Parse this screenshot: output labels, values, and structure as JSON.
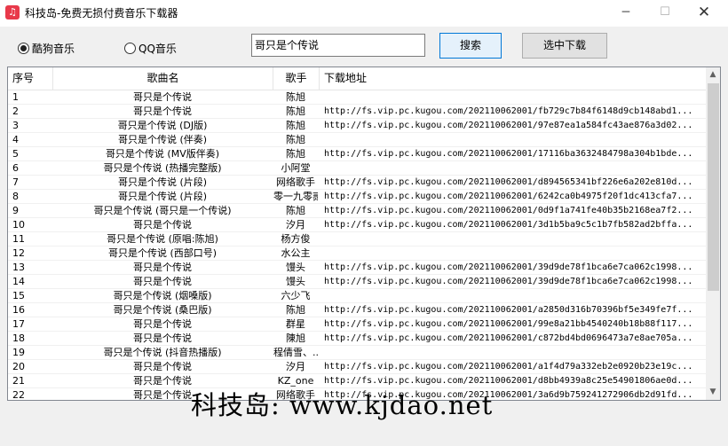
{
  "window": {
    "title": "科技岛-免费无损付费音乐下载器",
    "minimize_glyph": "─",
    "maximize_glyph": "☐",
    "close_glyph": "✕",
    "app_icon": "music-note-icon"
  },
  "toolbar": {
    "source_kugou_label": "酷狗音乐",
    "source_qq_label": "QQ音乐",
    "selected_source": "kugou",
    "search_value": "哥只是个传说",
    "search_button_label": "搜索",
    "download_selected_label": "选中下载"
  },
  "table": {
    "headers": [
      "序号",
      "歌曲名",
      "歌手",
      "下载地址"
    ],
    "rows": [
      {
        "no": "1",
        "song": "哥只是个传说",
        "singer": "陈旭",
        "url": ""
      },
      {
        "no": "2",
        "song": "哥只是个传说",
        "singer": "陈旭",
        "url": "http://fs.vip.pc.kugou.com/202110062001/fb729c7b84f6148d9cb148abd1..."
      },
      {
        "no": "3",
        "song": "哥只是个传说 (DJ版)",
        "singer": "陈旭",
        "url": "http://fs.vip.pc.kugou.com/202110062001/97e87ea1a584fc43ae876a3d02..."
      },
      {
        "no": "4",
        "song": "哥只是个传说 (伴奏)",
        "singer": "陈旭",
        "url": ""
      },
      {
        "no": "5",
        "song": "哥只是个传说 (MV版伴奏)",
        "singer": "陈旭",
        "url": "http://fs.vip.pc.kugou.com/202110062001/17116ba3632484798a304b1bde..."
      },
      {
        "no": "6",
        "song": "哥只是个传说 (热播完整版)",
        "singer": "小阿堂",
        "url": ""
      },
      {
        "no": "7",
        "song": "哥只是个传说 (片段)",
        "singer": "网络歌手",
        "url": "http://fs.vip.pc.kugou.com/202110062001/d894565341bf226e6a202e810d..."
      },
      {
        "no": "8",
        "song": "哥只是个传说 (片段)",
        "singer": "零一九零贰",
        "url": "http://fs.vip.pc.kugou.com/202110062001/6242ca0b4975f20f1dc413cfa7..."
      },
      {
        "no": "9",
        "song": "哥只是个传说 (哥只是一个传说)",
        "singer": "陈旭",
        "url": "http://fs.vip.pc.kugou.com/202110062001/0d9f1a741fe40b35b2168ea7f2..."
      },
      {
        "no": "10",
        "song": "哥只是个传说",
        "singer": "汐月",
        "url": "http://fs.vip.pc.kugou.com/202110062001/3d1b5ba9c5c1b7fb582ad2bffa..."
      },
      {
        "no": "11",
        "song": "哥只是个传说 (原唱:陈旭)",
        "singer": "杨方俊",
        "url": ""
      },
      {
        "no": "12",
        "song": "哥只是个传说 (西部口号)",
        "singer": "水公主",
        "url": ""
      },
      {
        "no": "13",
        "song": "哥只是个传说",
        "singer": "馒头",
        "url": "http://fs.vip.pc.kugou.com/202110062001/39d9de78f1bca6e7ca062c1998..."
      },
      {
        "no": "14",
        "song": "哥只是个传说",
        "singer": "馒头",
        "url": "http://fs.vip.pc.kugou.com/202110062001/39d9de78f1bca6e7ca062c1998..."
      },
      {
        "no": "15",
        "song": "哥只是个传说 (烟嗓版)",
        "singer": "六少飞",
        "url": ""
      },
      {
        "no": "16",
        "song": "哥只是个传说 (桑巴版)",
        "singer": "陈旭",
        "url": "http://fs.vip.pc.kugou.com/202110062001/a2850d316b70396bf5e349fe7f..."
      },
      {
        "no": "17",
        "song": "哥只是个传说",
        "singer": "群星",
        "url": "http://fs.vip.pc.kugou.com/202110062001/99e8a21bb4540240b18b88f117..."
      },
      {
        "no": "18",
        "song": "哥只是个传说",
        "singer": "陳旭",
        "url": "http://fs.vip.pc.kugou.com/202110062001/c872bd4bd0696473a7e8ae705a..."
      },
      {
        "no": "19",
        "song": "哥只是个传说 (抖音热播版)",
        "singer": "程倩雪、...",
        "url": ""
      },
      {
        "no": "20",
        "song": "哥只是个传说",
        "singer": "汐月",
        "url": "http://fs.vip.pc.kugou.com/202110062001/a1f4d79a332eb2e0920b23e19c..."
      },
      {
        "no": "21",
        "song": "哥只是个传说",
        "singer": "KZ_one",
        "url": "http://fs.vip.pc.kugou.com/202110062001/d8bb4939a8c25e54901806ae0d..."
      },
      {
        "no": "22",
        "song": "哥只是个传说",
        "singer": "网络歌手",
        "url": "http://fs.vip.pc.kugou.com/202110062001/3a6d9b759241272906db2d91fd..."
      }
    ]
  },
  "footer": {
    "watermark": "科技岛: www.kjdao.net"
  },
  "colors": {
    "app_icon": "#e8394a",
    "search_button_border": "#0078d7"
  }
}
